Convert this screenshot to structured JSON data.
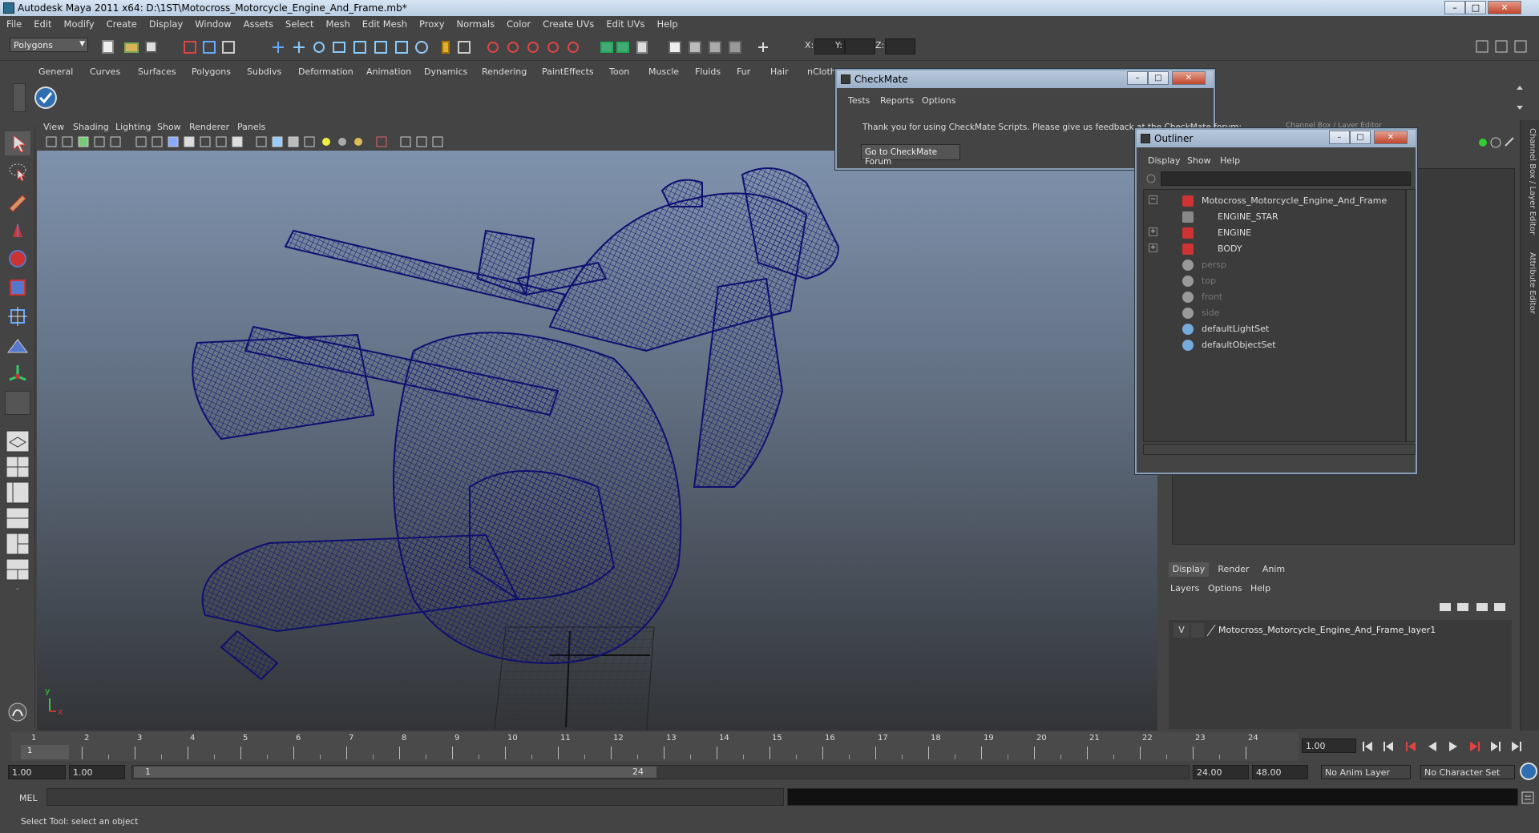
{
  "window": {
    "title": "Autodesk Maya 2011 x64: D:\\1ST\\Motocross_Motorcycle_Engine_And_Frame.mb*",
    "minimize": "–",
    "maximize": "□",
    "close": "✕"
  },
  "menubar": [
    "File",
    "Edit",
    "Modify",
    "Create",
    "Display",
    "Window",
    "Assets",
    "Select",
    "Mesh",
    "Edit Mesh",
    "Proxy",
    "Normals",
    "Color",
    "Create UVs",
    "Edit UVs",
    "Help"
  ],
  "statusline": {
    "menuset": "Polygons",
    "x_label": "X:",
    "y_label": "Y:",
    "z_label": "Z:"
  },
  "shelf": {
    "tabs": [
      "General",
      "Curves",
      "Surfaces",
      "Polygons",
      "Subdivs",
      "Deformation",
      "Animation",
      "Dynamics",
      "Rendering",
      "PaintEffects",
      "Toon",
      "Muscle",
      "Fluids",
      "Fur",
      "Hair",
      "nCloth"
    ],
    "active_tab": "nCloth"
  },
  "viewport": {
    "menu": [
      "View",
      "Shading",
      "Lighting",
      "Show",
      "Renderer",
      "Panels"
    ],
    "axis_y": "y",
    "axis_x": "x",
    "wire_color": "#0f0f70"
  },
  "checkmate": {
    "title": "CheckMate",
    "menu": [
      "Tests",
      "Reports",
      "Options"
    ],
    "message": "Thank you for using CheckMate Scripts. Please give us feedback at the CheckMate forum:",
    "button": "Go to CheckMate Forum"
  },
  "outliner": {
    "title": "Outliner",
    "menu": [
      "Display",
      "Show",
      "Help"
    ],
    "items": [
      {
        "label": "Motocross_Motorcycle_Engine_And_Frame",
        "indent": 0,
        "icon": "mesh-icon",
        "expand": "−",
        "dim": false
      },
      {
        "label": "ENGINE_STAR",
        "indent": 1,
        "icon": "locator-icon",
        "expand": "",
        "dim": false
      },
      {
        "label": "ENGINE",
        "indent": 1,
        "icon": "mesh-icon",
        "expand": "+",
        "dim": false
      },
      {
        "label": "BODY",
        "indent": 1,
        "icon": "mesh-icon",
        "expand": "+",
        "dim": false
      },
      {
        "label": "persp",
        "indent": 0,
        "icon": "camera-icon",
        "expand": "",
        "dim": true
      },
      {
        "label": "top",
        "indent": 0,
        "icon": "camera-icon",
        "expand": "",
        "dim": true
      },
      {
        "label": "front",
        "indent": 0,
        "icon": "camera-icon",
        "expand": "",
        "dim": true
      },
      {
        "label": "side",
        "indent": 0,
        "icon": "camera-icon",
        "expand": "",
        "dim": true
      },
      {
        "label": "defaultLightSet",
        "indent": 0,
        "icon": "set-icon",
        "expand": "",
        "dim": false
      },
      {
        "label": "defaultObjectSet",
        "indent": 0,
        "icon": "set-icon",
        "expand": "",
        "dim": false
      }
    ]
  },
  "channelbox": {
    "header": "Channel Box / Layer Editor",
    "side_tab_1": "Channel Box / Layer Editor",
    "side_tab_2": "Attribute Editor"
  },
  "layereditor": {
    "tabs": [
      "Display",
      "Render",
      "Anim"
    ],
    "active_tab": "Display",
    "menu": [
      "Layers",
      "Options",
      "Help"
    ],
    "layer": {
      "visible": "V",
      "name": "Motocross_Motorcycle_Engine_And_Frame_layer1"
    }
  },
  "timeslider": {
    "ticks": [
      "1",
      "2",
      "3",
      "4",
      "5",
      "6",
      "7",
      "8",
      "9",
      "10",
      "11",
      "12",
      "13",
      "14",
      "15",
      "16",
      "17",
      "18",
      "19",
      "20",
      "21",
      "22",
      "23",
      "24"
    ],
    "current_frame_marker": "1",
    "current_time": "1.00"
  },
  "rangeslider": {
    "start_time": "1.00",
    "playback_start": "1.00",
    "range_start_label": "1",
    "range_end_label": "24",
    "playback_end": "24.00",
    "end_time": "48.00",
    "anim_layer": "No Anim Layer",
    "character_set": "No Character Set"
  },
  "commandline": {
    "label": "MEL"
  },
  "helpline": {
    "text": "Select Tool: select an object"
  }
}
